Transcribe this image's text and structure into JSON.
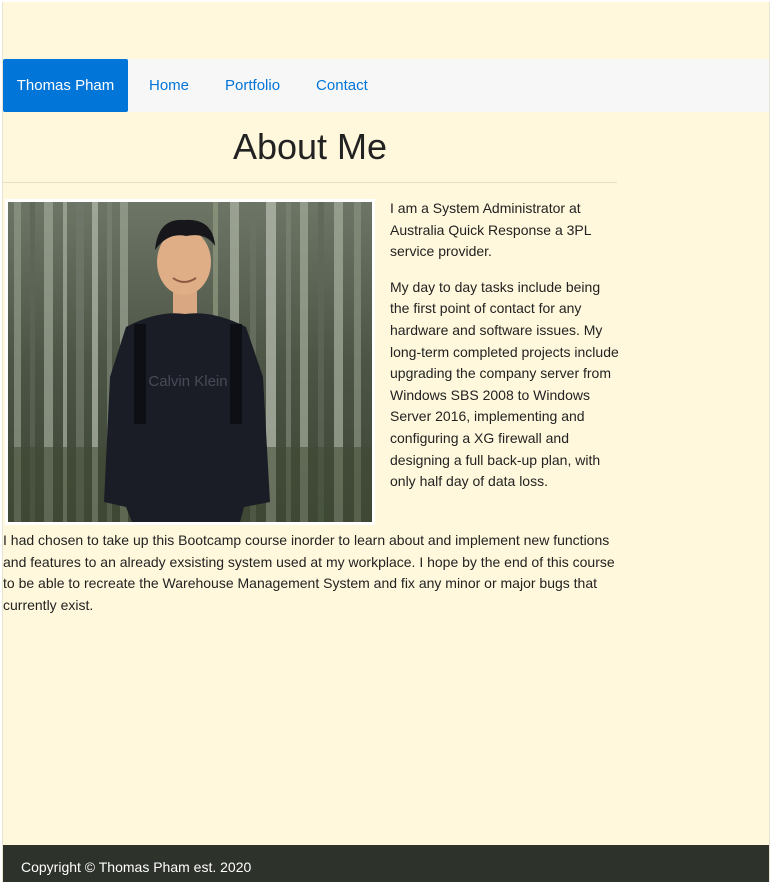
{
  "navbar": {
    "brand": "Thomas Pham",
    "links": [
      "Home",
      "Portfolio",
      "Contact"
    ]
  },
  "main": {
    "title": "About Me",
    "paragraph_1": "I am a System Administrator at Australia Quick Response a 3PL service provider.",
    "paragraph_2": "My day to day tasks include being the first point of contact for any hardware and software issues. My long-term completed projects include upgrading the company server from Windows SBS 2008 to Windows Server 2016, implementing and configuring a XG firewall and designing a full back-up plan, with only half day of data loss.",
    "paragraph_3": "I had chosen to take up this Bootcamp course inorder to learn about and implement new functions and features to an already exsisting system used at my workplace. I hope by the end of this course to be able to recreate the Warehouse Management System and fix any minor or major bugs that currently exist.",
    "photo_shirt_text": "Calvin Klein"
  },
  "footer": {
    "text": "Copyright © Thomas Pham est. 2020"
  },
  "colors": {
    "background": "#fff8dc",
    "navbar": "#f7f7f7",
    "accent": "#0275d8",
    "footer": "#2d322b"
  }
}
